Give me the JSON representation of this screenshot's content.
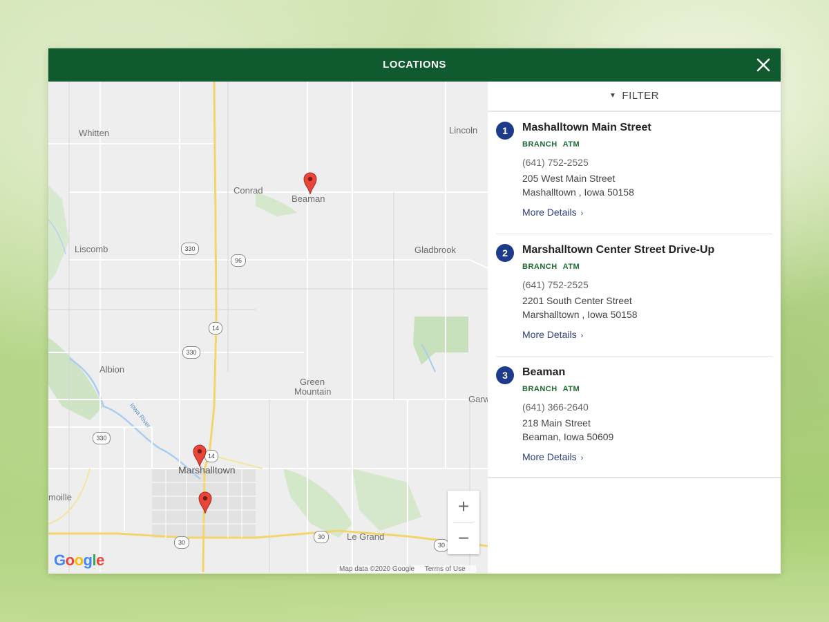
{
  "header": {
    "title": "LOCATIONS",
    "close_label": "×"
  },
  "filter": {
    "label": "FILTER"
  },
  "map": {
    "places": [
      "Whitten",
      "Lincoln",
      "Conrad",
      "Beaman",
      "Liscomb",
      "Gladbrook",
      "Albion",
      "Green",
      "Mountain",
      "Garw",
      "Marshalltown",
      "moille",
      "Le Grand",
      "Iowa River"
    ],
    "shields": [
      "330",
      "96",
      "14",
      "330",
      "330",
      "14",
      "30",
      "30",
      "30"
    ],
    "zoom_in": "+",
    "zoom_out": "−",
    "google_logo": "Google",
    "map_data": "Map data ©2020 Google",
    "terms": "Terms of Use"
  },
  "locations": [
    {
      "num": "1",
      "name": "Mashalltown Main Street",
      "tags": [
        "BRANCH",
        "ATM"
      ],
      "phone": "(641) 752-2525",
      "address1": "205 West Main Street",
      "address2": "Mashalltown , Iowa 50158",
      "more": "More Details"
    },
    {
      "num": "2",
      "name": "Marshalltown Center Street Drive-Up",
      "tags": [
        "BRANCH",
        "ATM"
      ],
      "phone": "(641) 752-2525",
      "address1": "2201 South Center Street",
      "address2": "Marshalltown , Iowa 50158",
      "more": "More Details"
    },
    {
      "num": "3",
      "name": "Beaman",
      "tags": [
        "BRANCH",
        "ATM"
      ],
      "phone": "(641) 366-2640",
      "address1": "218 Main Street",
      "address2": "Beaman, Iowa 50609",
      "more": "More Details"
    }
  ],
  "colors": {
    "header": "#0f5a2e",
    "accent_green": "#1a6b2f",
    "number_badge": "#1e3a8a",
    "link": "#2b3e7a",
    "marker": "#e8463a"
  },
  "icons": {
    "close": "close-icon",
    "filter_chevron": "chevron-down-icon",
    "details_chevron": "chevron-right-icon",
    "marker": "map-pin-icon"
  }
}
